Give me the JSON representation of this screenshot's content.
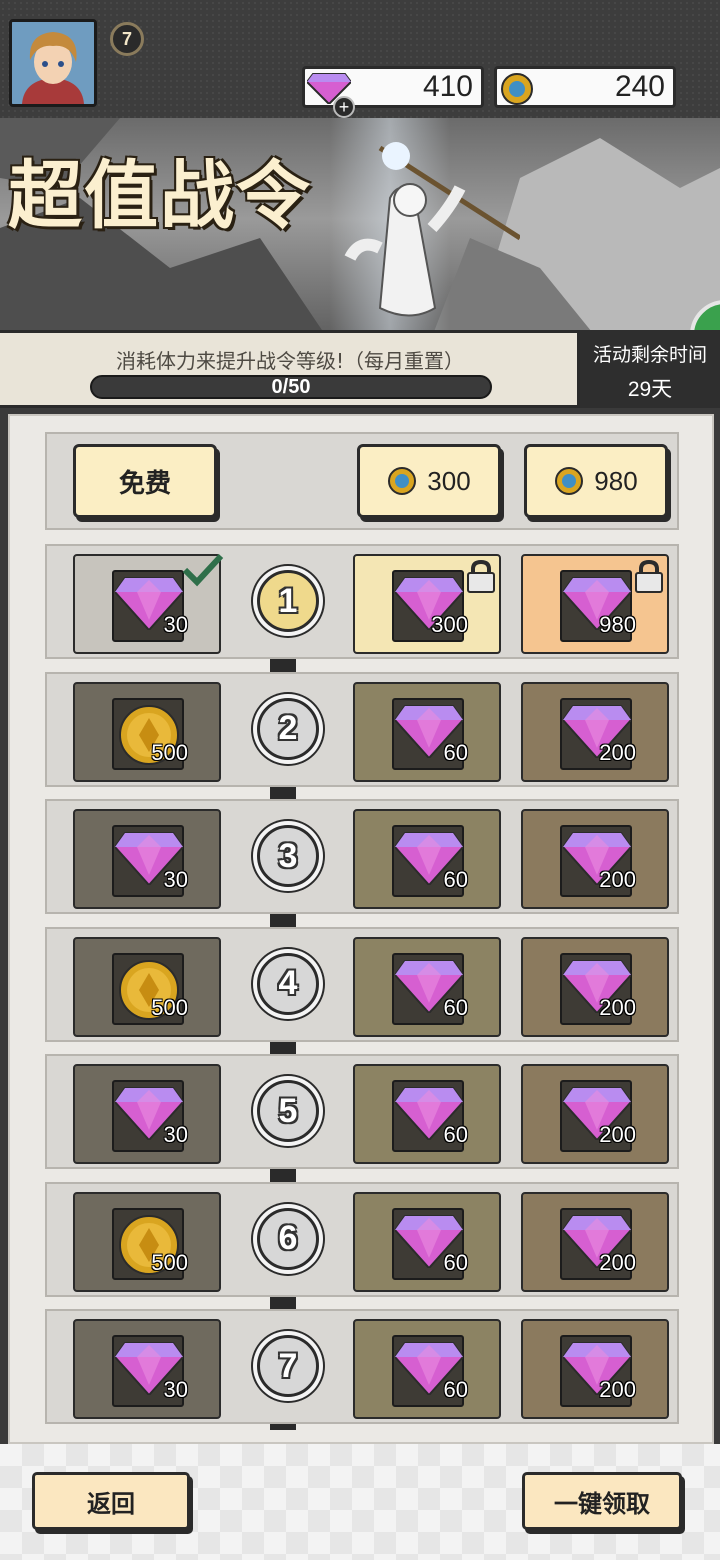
{
  "player": {
    "level": "7"
  },
  "currency": {
    "gems": "410",
    "coins": "240"
  },
  "banner": {
    "title": "超值战令"
  },
  "pass": {
    "hint": "消耗体力来提升战令等级!（每月重置）",
    "progress_text": "0/50",
    "progress_fraction": 0,
    "remaining_label": "活动剩余时间",
    "remaining_value": "29天"
  },
  "tiers": {
    "free": "免费",
    "tier2_price": "300",
    "tier3_price": "980"
  },
  "rows": [
    {
      "level": "1",
      "free": {
        "icon": "gem-icon",
        "amount": "30"
      },
      "t2": {
        "icon": "gem-icon",
        "amount": "300"
      },
      "t3": {
        "icon": "gem-icon",
        "amount": "980"
      }
    },
    {
      "level": "2",
      "free": {
        "icon": "gold-coin-icon",
        "amount": "500"
      },
      "t2": {
        "icon": "gem-icon",
        "amount": "60"
      },
      "t3": {
        "icon": "gem-icon",
        "amount": "200"
      }
    },
    {
      "level": "3",
      "free": {
        "icon": "gem-icon",
        "amount": "30"
      },
      "t2": {
        "icon": "gem-icon",
        "amount": "60"
      },
      "t3": {
        "icon": "gem-icon",
        "amount": "200"
      }
    },
    {
      "level": "4",
      "free": {
        "icon": "gold-coin-icon",
        "amount": "500"
      },
      "t2": {
        "icon": "gem-icon",
        "amount": "60"
      },
      "t3": {
        "icon": "gem-icon",
        "amount": "200"
      }
    },
    {
      "level": "5",
      "free": {
        "icon": "gem-icon",
        "amount": "30"
      },
      "t2": {
        "icon": "gem-icon",
        "amount": "60"
      },
      "t3": {
        "icon": "gem-icon",
        "amount": "200"
      }
    },
    {
      "level": "6",
      "free": {
        "icon": "gold-coin-icon",
        "amount": "500"
      },
      "t2": {
        "icon": "gem-icon",
        "amount": "60"
      },
      "t3": {
        "icon": "gem-icon",
        "amount": "200"
      }
    },
    {
      "level": "7",
      "free": {
        "icon": "gem-icon",
        "amount": "30"
      },
      "t2": {
        "icon": "gem-icon",
        "amount": "60"
      },
      "t3": {
        "icon": "gem-icon",
        "amount": "200"
      }
    }
  ],
  "buttons": {
    "back": "返回",
    "claim_all": "一键领取"
  },
  "colors": {
    "gem": "#d65fd1",
    "coin": "#d9a520",
    "paper": "#fbeec4",
    "dark": "#2b2b2b"
  }
}
